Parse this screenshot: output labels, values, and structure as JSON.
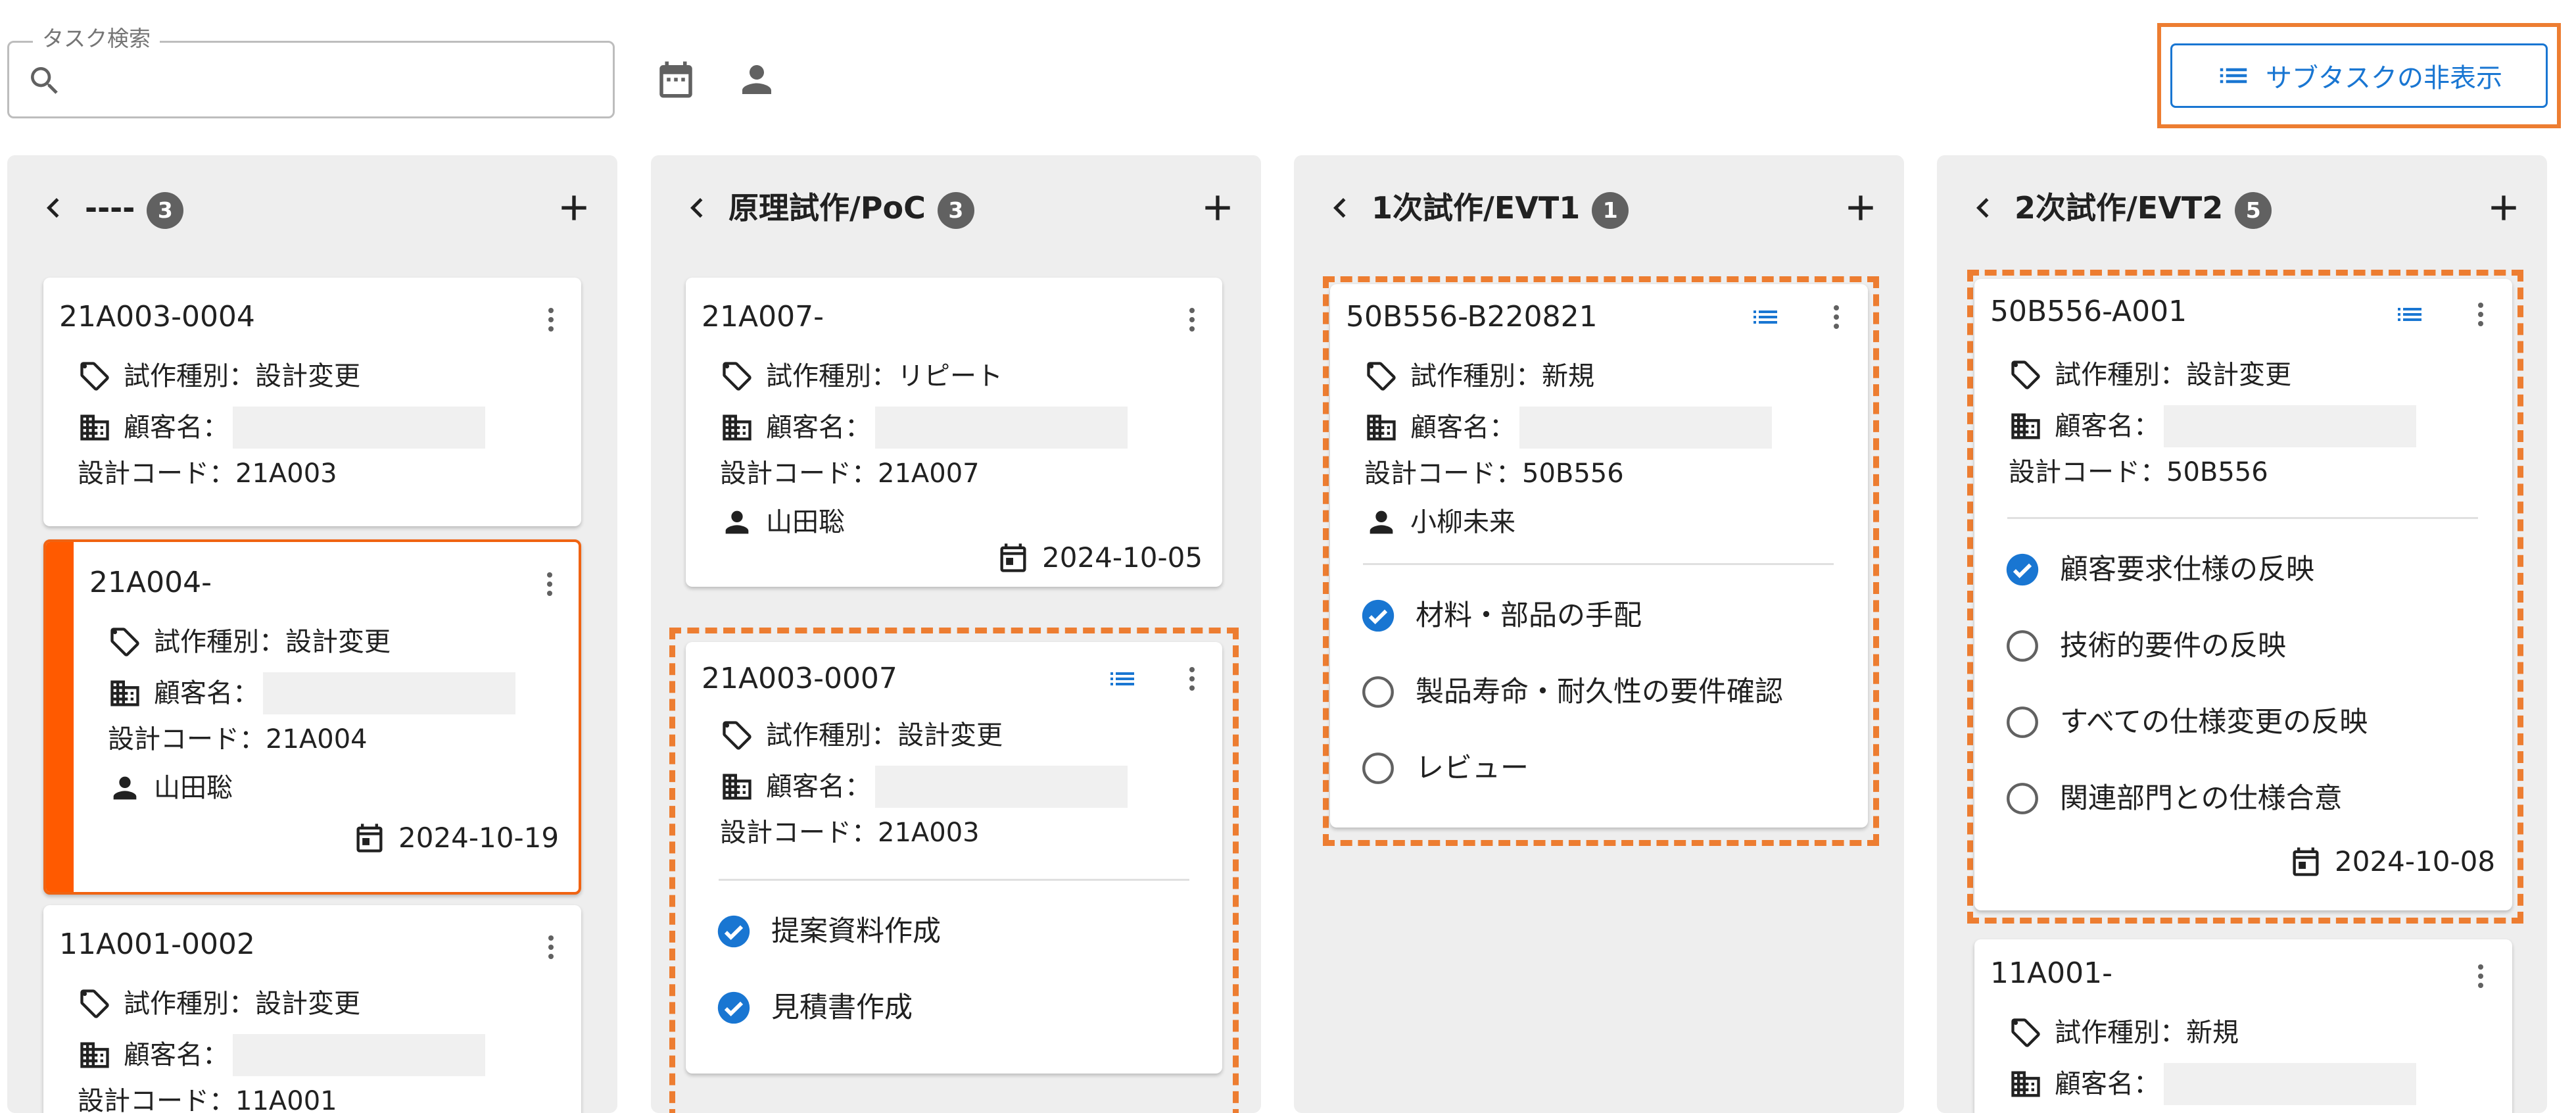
{
  "search": {
    "label": "タスク検索",
    "value": "",
    "placeholder": ""
  },
  "toolbar": {
    "calendar_icon": "calendar-icon",
    "person_icon": "person-icon",
    "subtask_toggle_label": "サブタスクの非表示"
  },
  "colors": {
    "accent": "#1976d2",
    "highlight": "#ed7d31",
    "selected_stripe": "#ff5a00",
    "column_bg": "#eeeeee"
  },
  "columns": [
    {
      "title": "----",
      "count": "3",
      "cards": [
        {
          "id": "21A003-0004",
          "type": "試作種別：設計変更",
          "customer_label": "顧客名：",
          "code": "設計コード：21A003"
        },
        {
          "id": "21A004-",
          "type": "試作種別：設計変更",
          "customer_label": "顧客名：",
          "code": "設計コード：21A004",
          "assignee": "山田聡",
          "date": "2024-10-19"
        },
        {
          "id": "11A001-0002",
          "type": "試作種別：設計変更",
          "customer_label": "顧客名：",
          "code": "設計コード：11A001"
        }
      ]
    },
    {
      "title": "原理試作/PoC",
      "count": "3",
      "cards": [
        {
          "id": "21A007-",
          "type": "試作種別：リピート",
          "customer_label": "顧客名：",
          "code": "設計コード：21A007",
          "assignee": "山田聡",
          "date": "2024-10-05"
        },
        {
          "id": "21A003-0007",
          "type": "試作種別：設計変更",
          "customer_label": "顧客名：",
          "code": "設計コード：21A003",
          "subtasks": [
            {
              "label": "提案資料作成",
              "done": true
            },
            {
              "label": "見積書作成",
              "done": true
            }
          ]
        }
      ]
    },
    {
      "title": "1次試作/EVT1",
      "count": "1",
      "cards": [
        {
          "id": "50B556-B220821",
          "type": "試作種別：新規",
          "customer_label": "顧客名：",
          "code": "設計コード：50B556",
          "assignee": "小柳未来",
          "subtasks": [
            {
              "label": "材料・部品の手配",
              "done": true
            },
            {
              "label": "製品寿命・耐久性の要件確認",
              "done": false
            },
            {
              "label": "レビュー",
              "done": false
            }
          ]
        }
      ]
    },
    {
      "title": "2次試作/EVT2",
      "count": "5",
      "cards": [
        {
          "id": "50B556-A001",
          "type": "試作種別：設計変更",
          "customer_label": "顧客名：",
          "code": "設計コード：50B556",
          "date": "2024-10-08",
          "subtasks": [
            {
              "label": "顧客要求仕様の反映",
              "done": true
            },
            {
              "label": "技術的要件の反映",
              "done": false
            },
            {
              "label": "すべての仕様変更の反映",
              "done": false
            },
            {
              "label": "関連部門との仕様合意",
              "done": false
            }
          ]
        },
        {
          "id": "11A001-",
          "type": "試作種別：新規",
          "customer_label": "顧客名："
        }
      ]
    }
  ]
}
